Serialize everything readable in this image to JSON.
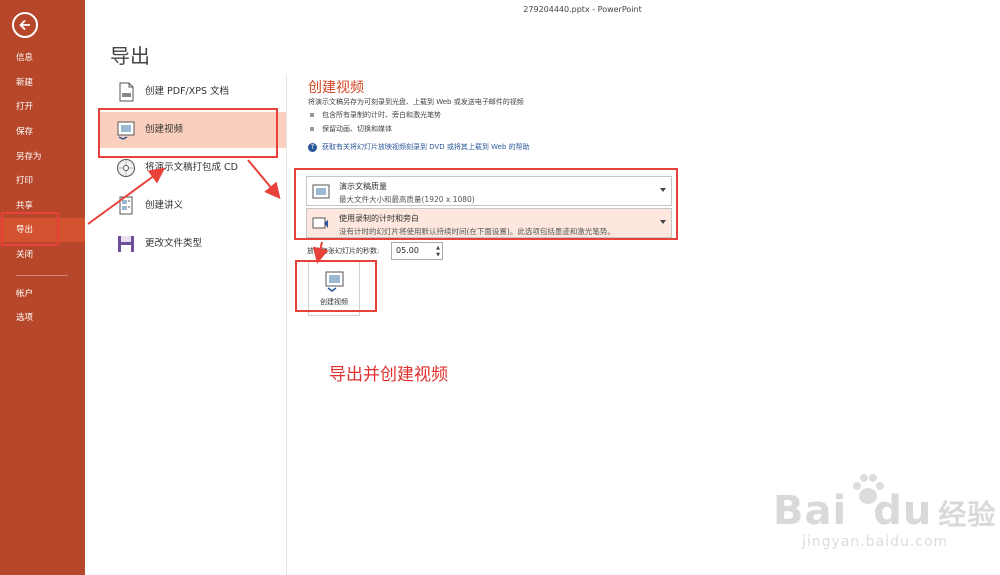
{
  "window": {
    "title": "279204440.pptx - PowerPoint"
  },
  "sidebar": {
    "items": [
      {
        "label": "信息"
      },
      {
        "label": "新建"
      },
      {
        "label": "打开"
      },
      {
        "label": "保存"
      },
      {
        "label": "另存为"
      },
      {
        "label": "打印"
      },
      {
        "label": "共享"
      },
      {
        "label": "导出",
        "active": true
      },
      {
        "label": "关闭"
      },
      {
        "label": "帐户"
      },
      {
        "label": "选项"
      }
    ],
    "colors": {
      "background": "#b7472a",
      "active": "#d35230"
    }
  },
  "page": {
    "title": "导出"
  },
  "export_options": [
    {
      "label": "创建 PDF/XPS 文档",
      "icon": "pdf-document-icon"
    },
    {
      "label": "创建视频",
      "icon": "video-icon",
      "selected": true
    },
    {
      "label": "将演示文稿打包成 CD",
      "icon": "cd-icon"
    },
    {
      "label": "创建讲义",
      "icon": "handout-icon"
    },
    {
      "label": "更改文件类型",
      "icon": "save-icon"
    }
  ],
  "video_panel": {
    "heading": "创建视频",
    "description": "将演示文稿另存为可刻录到光盘、上载到 Web 或发送电子邮件的视频",
    "bullets": [
      "包含所有录制的计时、旁白和激光笔势",
      "保留动画、切换和媒体"
    ],
    "help_link": "获取有关将幻灯片放映视频刻录到 DVD 或将其上载到 Web 的帮助",
    "quality_dropdown": {
      "title": "演示文稿质量",
      "subtitle": "最大文件大小和最高质量(1920 x 1080)"
    },
    "timing_dropdown": {
      "title": "使用录制的计时和旁白",
      "subtitle": "没有计时的幻灯片将使用默认持续时间(在下面设置)。此选项包括墨迹和激光笔势。"
    },
    "seconds_label": "放映每张幻灯片的秒数:",
    "seconds_value": "05.00",
    "create_button_label": "创建视频"
  },
  "annotation": {
    "text": "导出并创建视频",
    "color": "#e0302d"
  },
  "watermark": {
    "logo": "Bai",
    "logo_tail": "du",
    "cn": "经验",
    "url": "jingyan.baidu.com"
  }
}
